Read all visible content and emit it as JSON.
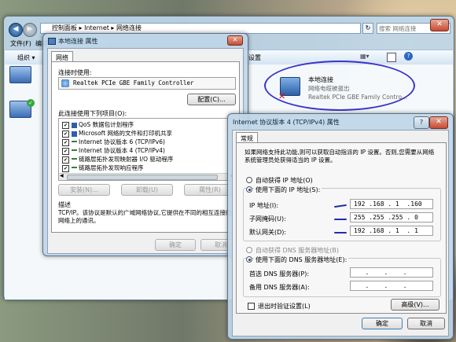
{
  "explorer": {
    "breadcrumb": [
      "控制面板",
      "Internet",
      "网络连接"
    ],
    "search_placeholder": "搜索 网络连接",
    "menu": [
      "文件(F)",
      "编辑"
    ],
    "organize_label": "组织",
    "toolbar_tail": "设置",
    "adapter": {
      "name": "本地连接",
      "status": "网络电缆被拔出",
      "device": "Realtek PCIe GBE Family Contro..."
    }
  },
  "props_dialog": {
    "title": "本地连接 属性",
    "tab": "网络",
    "connect_using_label": "连接时使用:",
    "adapter_name": "Realtek PCIe GBE Family Controller",
    "configure_button": "配置(C)...",
    "items_label": "此连接使用下列项目(O):",
    "items": [
      {
        "label": "QoS 数据包计划程序",
        "checked": true
      },
      {
        "label": "Microsoft 网络的文件和打印机共享",
        "checked": true
      },
      {
        "label": "Internet 协议版本 6 (TCP/IPv6)",
        "checked": true
      },
      {
        "label": "Internet 协议版本 4 (TCP/IPv4)",
        "checked": true
      },
      {
        "label": "链路层拓扑发现映射器 I/O 驱动程序",
        "checked": true
      },
      {
        "label": "链路层拓扑发现响应程序",
        "checked": true
      }
    ],
    "install_button": "安装(N)...",
    "uninstall_button": "卸载(U)",
    "properties_button": "属性(R)",
    "description_title": "描述",
    "description_text": "TCP/IP。该协议是默认的广域网络协议,它提供在不同的相互连接的网络上的通讯。",
    "ok_button": "确定",
    "cancel_button": "取消"
  },
  "ipv4_dialog": {
    "title": "Internet 协议版本 4 (TCP/IPv4) 属性",
    "help_icon": "?",
    "tab": "常规",
    "intro_text": "如果网络支持此功能,则可以获取自动指派的 IP 设置。否则,您需要从网络系统管理员处获得适当的 IP 设置。",
    "auto_ip_label": "自动获得 IP 地址(O)",
    "manual_ip_label": "使用下面的 IP 地址(S):",
    "ip_label": "IP 地址(I):",
    "ip_value": "192 .168 . 1  .160",
    "mask_label": "子网掩码(U):",
    "mask_value": "255 .255 .255 . 0",
    "gateway_label": "默认网关(D):",
    "gateway_value": "192 .168 . 1  . 1",
    "auto_dns_label": "自动获得 DNS 服务器地址(B)",
    "manual_dns_label": "使用下面的 DNS 服务器地址(E):",
    "dns1_label": "首选 DNS 服务器(P):",
    "dns2_label": "备用 DNS 服务器(A):",
    "dns_empty": "   .    .    .",
    "validate_label": "退出时验证设置(L)",
    "advanced_button": "高级(V)...",
    "ok_button": "确定",
    "cancel_button": "取消",
    "auto_ip_selected": false,
    "manual_ip_selected": true,
    "auto_dns_selected": false,
    "manual_dns_selected": true,
    "validate_checked": false
  },
  "colors": {
    "annotation": "#1f2fa8",
    "close_button": "#c84b31",
    "selection": "#3399ff"
  }
}
